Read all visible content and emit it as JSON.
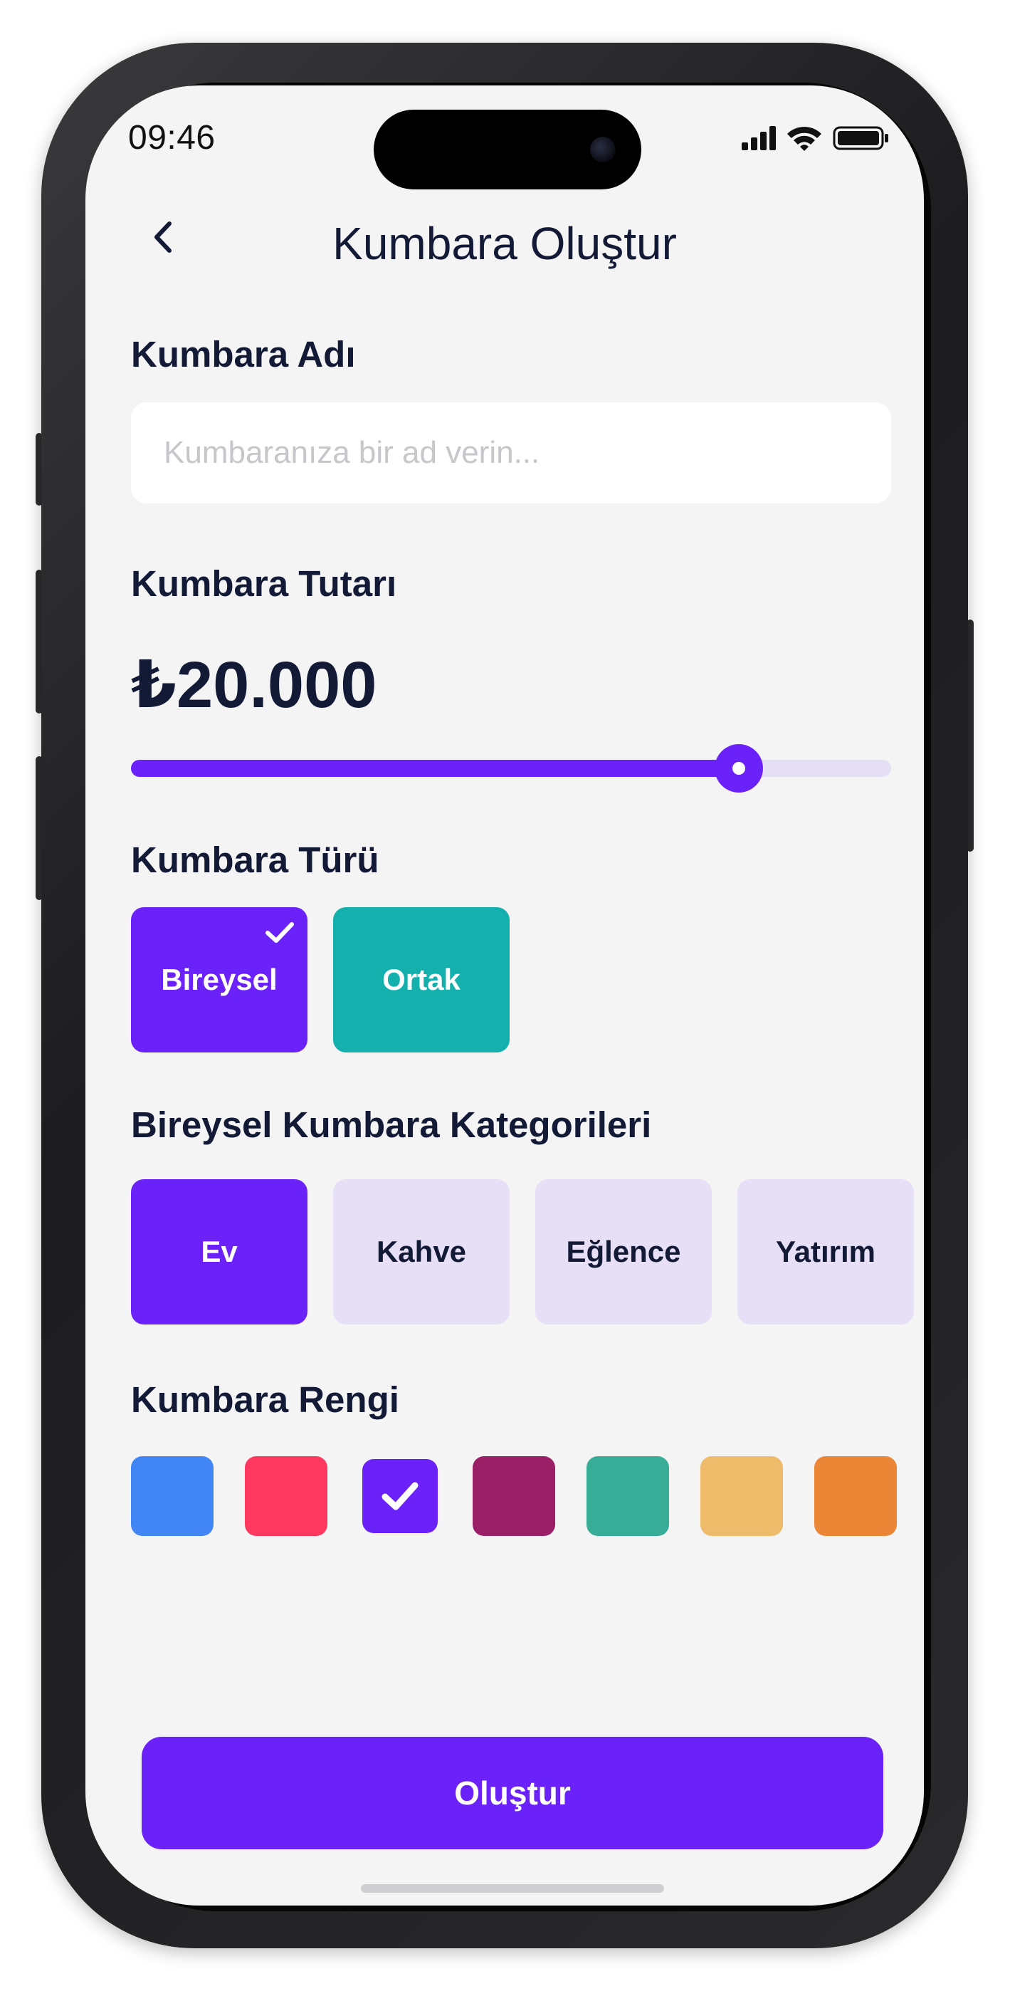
{
  "status_bar": {
    "time": "09:46"
  },
  "header": {
    "title": "Kumbara Oluştur",
    "back_icon": "chevron-left-icon"
  },
  "name_section": {
    "label": "Kumbara Adı",
    "input_value": "",
    "input_placeholder": "Kumbaranıza bir ad verin..."
  },
  "amount_section": {
    "label": "Kumbara Tutarı",
    "amount": "₺20.000",
    "slider_fraction": 0.8
  },
  "type_section": {
    "label": "Kumbara Türü",
    "options": [
      {
        "label": "Bireysel",
        "selected": true,
        "color": "#6b22f9"
      },
      {
        "label": "Ortak",
        "selected": false,
        "color": "#14b0ad"
      }
    ]
  },
  "category_section": {
    "label": "Bireysel Kumbara Kategorileri",
    "options": [
      {
        "label": "Ev",
        "selected": true
      },
      {
        "label": "Kahve",
        "selected": false
      },
      {
        "label": "Eğlence",
        "selected": false
      },
      {
        "label": "Yatırım",
        "selected": false
      }
    ]
  },
  "color_section": {
    "label": "Kumbara Rengi",
    "swatches": [
      {
        "color": "#4285f4",
        "selected": false
      },
      {
        "color": "#fe385e",
        "selected": false
      },
      {
        "color": "#6b22f9",
        "selected": true
      },
      {
        "color": "#9a1f66",
        "selected": false
      },
      {
        "color": "#37ad98",
        "selected": false
      },
      {
        "color": "#edbb69",
        "selected": false
      },
      {
        "color": "#ec8637",
        "selected": false
      }
    ]
  },
  "actions": {
    "create_label": "Oluştur"
  },
  "colors": {
    "accent": "#6b22f9",
    "accent_light": "#e6dff5",
    "text_dark": "#131a36",
    "teal": "#14b0ad"
  }
}
